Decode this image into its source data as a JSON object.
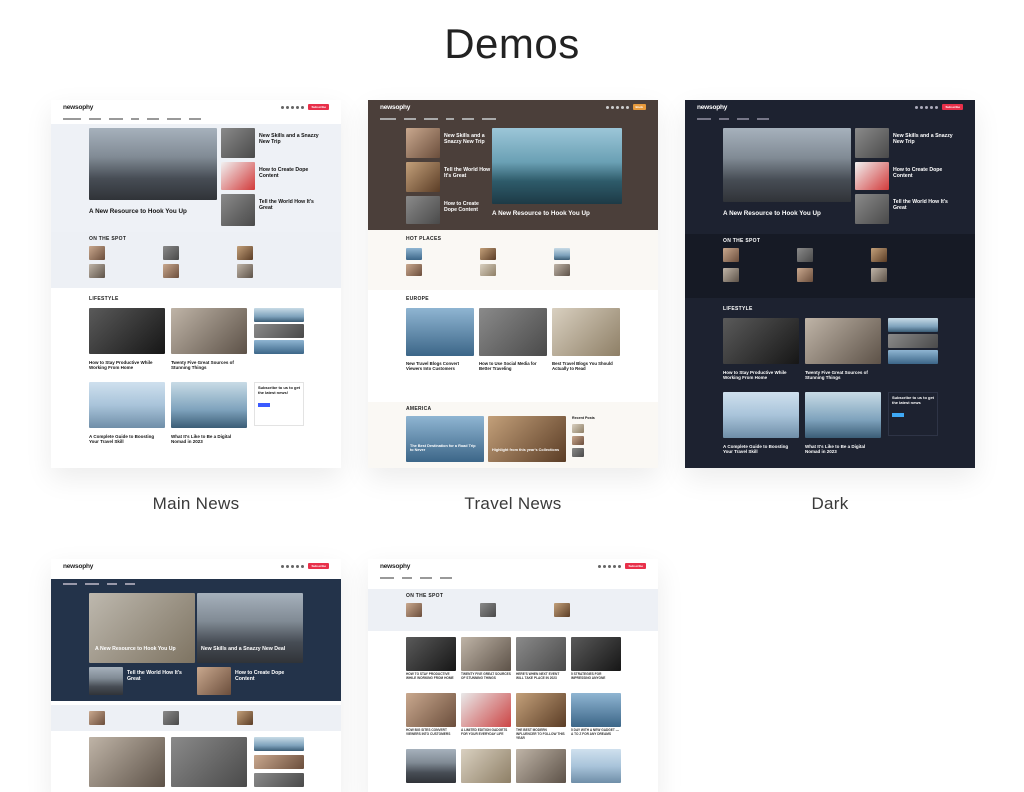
{
  "page": {
    "title": "Demos"
  },
  "colors": {
    "accent_red": "#e8304a",
    "accent_orange": "#e89a3c",
    "dark_bg": "#1d2230",
    "navy_bg": "#23334a",
    "light_panel": "#edf0f5",
    "travel_hero": "#4b3f3a"
  },
  "demos": [
    {
      "label": "Main News",
      "logo": "newsophy",
      "cta": "Subscribe",
      "hero_title": "A New Resource to Hook You Up",
      "side": [
        "New Skills and a Snazzy New Trip",
        "How to Create Dope Content",
        "Tell the World How It's Great"
      ],
      "section_spot": "ON THE SPOT",
      "section_life": "LIFESTYLE",
      "posts": [
        "How to Stay Productive While Working From Home",
        "Twenty Five Great Sources of Stunning Things",
        "A Complete Guide to Boosting Your Travel Skill",
        "What It's Like to Be a Digital Nomad in 2023"
      ],
      "subscribe": "Subscribe to us to get the latest news!"
    },
    {
      "label": "Travel News",
      "logo": "newsophy",
      "cta": "Book",
      "hero_title": "A New Resource to Hook You Up",
      "side": [
        "New Skills and a Snazzy New Trip",
        "Tell the World How It's Great",
        "How to Create Dope Content"
      ],
      "section_hot": "HOT PLACES",
      "section_europe": "EUROPE",
      "section_america": "AMERICA",
      "posts": [
        "New Travel Blogs Convert Viewers Into Customers",
        "How to Use Social Media for Better Traveling",
        "Best Travel Blogs You Should Actually to Read"
      ],
      "america_posts": [
        "The Best Destination for a Road Trip to Never",
        "Highlight from this year's Collections"
      ],
      "recent": "Recent Posts"
    },
    {
      "label": "Dark",
      "logo": "newsophy",
      "cta": "Subscribe",
      "hero_title": "A New Resource to Hook You Up",
      "side": [
        "New Skills and a Snazzy New Trip",
        "How to Create Dope Content",
        "Tell the World How It's Great"
      ],
      "section_spot": "ON THE SPOT",
      "section_life": "LIFESTYLE",
      "posts": [
        "How to Stay Productive While Working From Home",
        "Twenty Five Great Sources of Stunning Things",
        "A Complete Guide to Boosting Your Travel Skill",
        "What It's Like to Be a Digital Nomad in 2023"
      ],
      "subscribe": "Subscribe to us to get the latest news"
    },
    {
      "logo": "newsophy",
      "cta": "Subscribe",
      "hero_left": "A New Resource to Hook You Up",
      "hero_right": "New Skills and a Snazzy New Deal",
      "bottom_left": "Tell the World How It's Great",
      "bottom_right": "How to Create Dope Content"
    },
    {
      "logo": "newsophy",
      "cta": "Subscribe",
      "section_spot": "ON THE SPOT",
      "grid_titles": [
        "HOW TO STAY PRODUCTIVE WHILE WORKING FROM HOME",
        "TWENTY FIVE GREAT SOURCES OF STUNNING THINGS",
        "HERE'S WHEN NEXT EVENT WILL TAKE PLACE IN 2023",
        "5 STRATEGIES FOR IMPRESSING ANYONE",
        "HOW BIG SITES CONVERT VIEWERS INTO CUSTOMERS",
        "A LIMITED EDITION GADGETS FOR YOUR EVERYDAY LIFE",
        "THE BEST MODERN INFLUENCER TO FOLLOW THIS YEAR",
        "5 DAY WITH A NEW GADGET — A TO Z FOR ANY DREAMS"
      ]
    }
  ]
}
